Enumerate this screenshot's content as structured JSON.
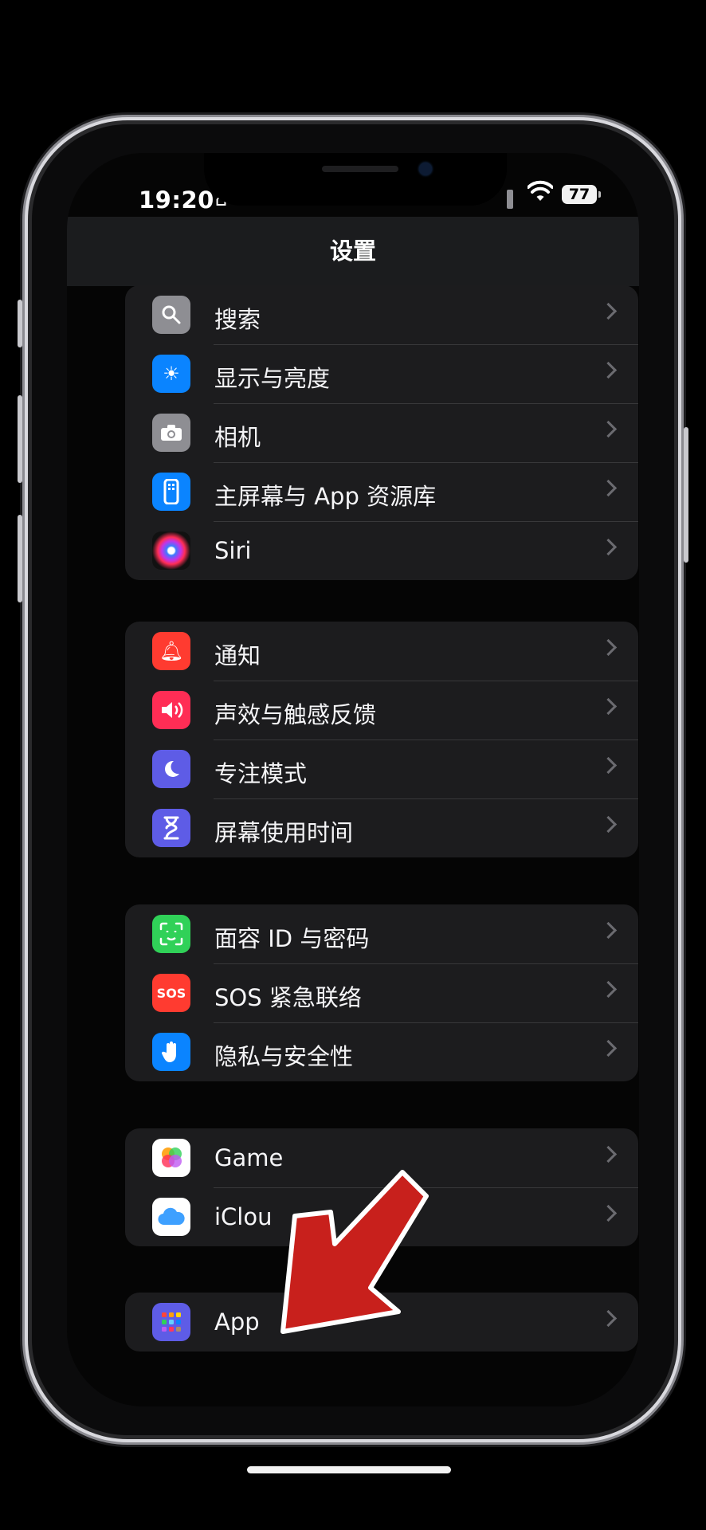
{
  "status": {
    "time": "19:20",
    "battery": "77"
  },
  "nav": {
    "title": "设置"
  },
  "groups": [
    {
      "items": [
        {
          "label": "搜索",
          "icon": "search-icon",
          "color": "#8e8e93"
        },
        {
          "label": "显示与亮度",
          "icon": "brightness-icon",
          "color": "#0a84ff"
        },
        {
          "label": "相机",
          "icon": "camera-icon",
          "color": "#8e8e93"
        },
        {
          "label": "主屏幕与 App 资源库",
          "icon": "home-screen-icon",
          "color": "#0a84ff"
        },
        {
          "label": "Siri",
          "icon": "siri-icon",
          "color": "#1c1c1e"
        }
      ]
    },
    {
      "items": [
        {
          "label": "通知",
          "icon": "bell-icon",
          "color": "#ff3b30"
        },
        {
          "label": "声效与触感反馈",
          "icon": "speaker-icon",
          "color": "#ff2d55"
        },
        {
          "label": "专注模式",
          "icon": "moon-icon",
          "color": "#5e5ce6"
        },
        {
          "label": "屏幕使用时间",
          "icon": "hourglass-icon",
          "color": "#5e5ce6"
        }
      ]
    },
    {
      "items": [
        {
          "label": "面容 ID 与密码",
          "icon": "face-id-icon",
          "color": "#30d158"
        },
        {
          "label": "SOS 紧急联络",
          "icon": "sos-icon",
          "icon_text": "SOS",
          "color": "#ff3b30"
        },
        {
          "label": "隐私与安全性",
          "icon": "hand-icon",
          "color": "#0a84ff"
        }
      ]
    },
    {
      "items": [
        {
          "label": "Game",
          "icon": "game-center-icon",
          "color": "#ffffff"
        },
        {
          "label": "iClou",
          "icon": "icloud-icon",
          "color": "#ffffff"
        }
      ]
    },
    {
      "items": [
        {
          "label": "App",
          "icon": "app-grid-icon",
          "color": "#5e5ce6"
        }
      ]
    }
  ]
}
